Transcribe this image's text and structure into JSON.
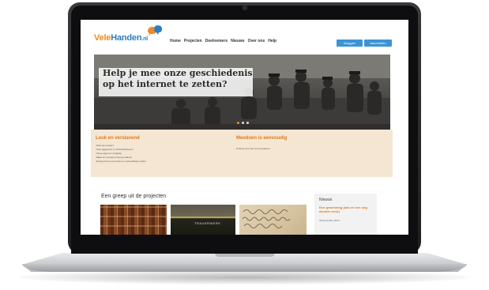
{
  "site": {
    "logo": {
      "part1": "Vele",
      "part2": "Handen",
      "part3": ".nl"
    },
    "nav": [
      "Home",
      "Projecten",
      "Deelnemers",
      "Nieuws",
      "Over ons",
      "Help"
    ],
    "buttons": {
      "login": "Inloggen",
      "register": "Aanmelden"
    },
    "hero": {
      "title": "Help je mee onze geschiedenis op het internet te zetten?",
      "slides": 3,
      "active_slide": 1
    },
    "band": {
      "left_title": "Leuk en verslavend",
      "left_items": [
        "Kies een project",
        "Voer gegevens in of beschrijf foto's",
        "Vul je eigen pc of laptop",
        "Maar en voorrener het jou uitkomt",
        "Energy bij op een fouten en aanvullingen wijzer"
      ],
      "right_title": "Meedoen is eenvoudig",
      "right_text": "Probeer een van onze projecten"
    },
    "projects": {
      "heading": "Een greep uit de projecten",
      "thumb2_label": "TRAUERWERK"
    },
    "news": {
      "heading": "Nieuws",
      "item_title": "Een gewenning (aan en een nog wonder zeno)",
      "item_date": "30 December 2020"
    },
    "colors": {
      "accent_orange": "#f08a24",
      "brand_blue": "#2b7fbe",
      "band_bg": "#f4e6d3",
      "button_blue": "#3b94d4"
    }
  }
}
